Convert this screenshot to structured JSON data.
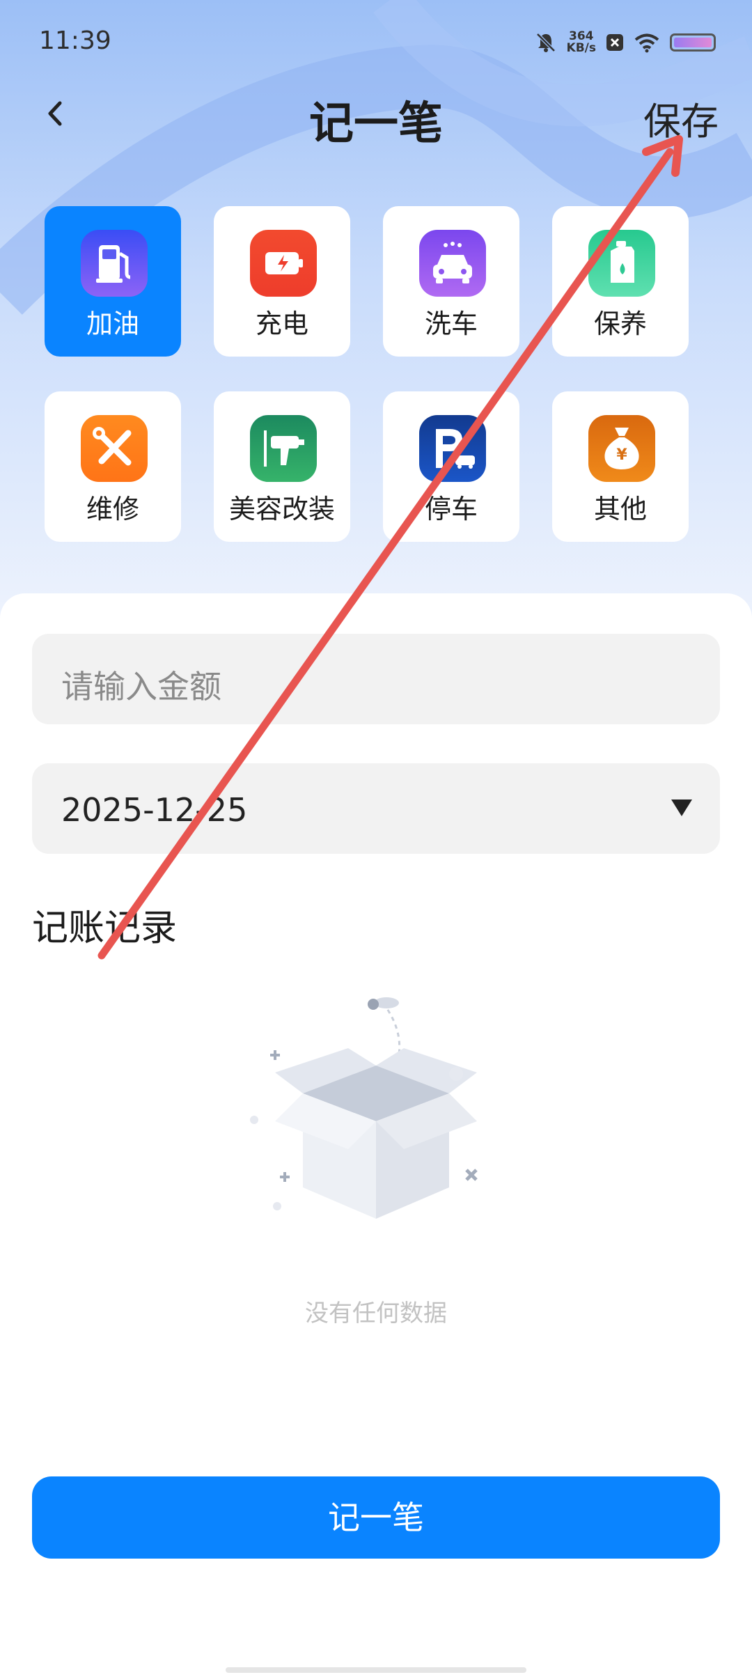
{
  "status_bar": {
    "time": "11:39",
    "net_speed_value": "364",
    "net_speed_unit": "KB/s",
    "icons": [
      "mute-bell-icon",
      "close-box-icon",
      "wifi-icon",
      "battery-icon"
    ]
  },
  "header": {
    "title": "记一笔",
    "save_label": "保存",
    "back_icon": "chevron-left-icon"
  },
  "categories": [
    {
      "label": "加油",
      "icon": "fuel-pump-icon",
      "active": true
    },
    {
      "label": "充电",
      "icon": "battery-charge-icon",
      "active": false
    },
    {
      "label": "洗车",
      "icon": "car-wash-icon",
      "active": false
    },
    {
      "label": "保养",
      "icon": "oil-can-icon",
      "active": false
    },
    {
      "label": "维修",
      "icon": "wrench-screwdriver-icon",
      "active": false
    },
    {
      "label": "美容改装",
      "icon": "spray-gun-icon",
      "active": false
    },
    {
      "label": "停车",
      "icon": "parking-icon",
      "active": false
    },
    {
      "label": "其他",
      "icon": "money-bag-icon",
      "active": false
    }
  ],
  "form": {
    "amount_placeholder": "请输入金额",
    "date_value": "2025-12-25"
  },
  "records": {
    "section_title": "记账记录",
    "empty_text": "没有任何数据"
  },
  "primary_button": "记一笔",
  "colors": {
    "accent": "#0a84ff",
    "annotation_arrow": "#e85550"
  }
}
